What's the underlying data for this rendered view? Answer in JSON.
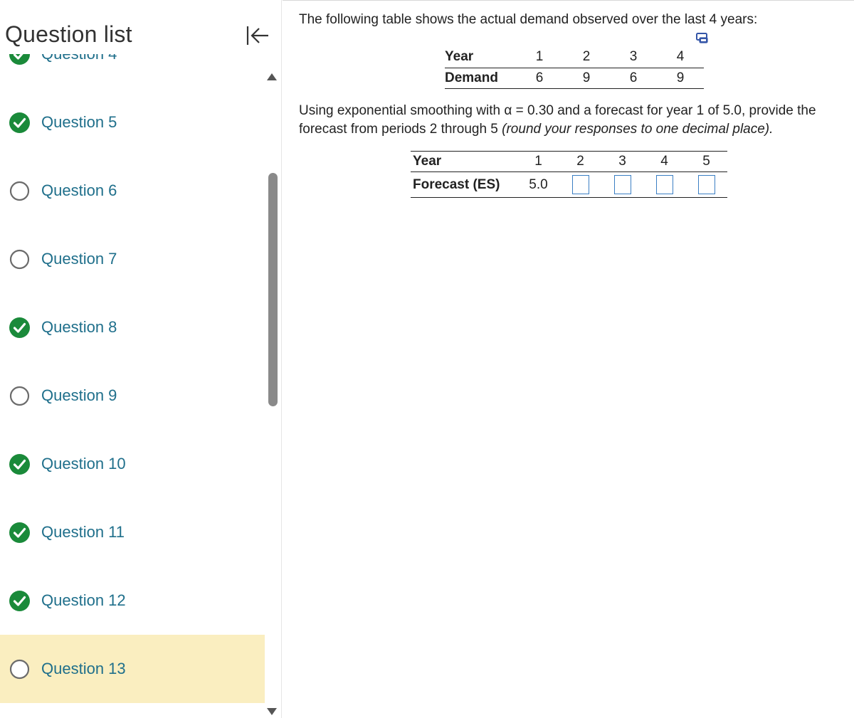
{
  "sidebar": {
    "title": "Question list",
    "items": [
      {
        "label": "Question 4",
        "status": "complete"
      },
      {
        "label": "Question 5",
        "status": "complete"
      },
      {
        "label": "Question 6",
        "status": "incomplete"
      },
      {
        "label": "Question 7",
        "status": "incomplete"
      },
      {
        "label": "Question 8",
        "status": "complete"
      },
      {
        "label": "Question 9",
        "status": "incomplete"
      },
      {
        "label": "Question 10",
        "status": "complete"
      },
      {
        "label": "Question 11",
        "status": "complete"
      },
      {
        "label": "Question 12",
        "status": "complete"
      },
      {
        "label": "Question 13",
        "status": "incomplete",
        "current": true
      }
    ]
  },
  "colors": {
    "complete": "#1a8a3a",
    "incomplete_ring": "#6b6b6b",
    "link": "#1f6f8b",
    "current_bg": "#faeec0",
    "input_border": "#3b7fc4"
  },
  "icons": {
    "collapse": "collapse-left-icon",
    "copy": "copy-table-icon",
    "complete": "check-circle-icon",
    "incomplete": "empty-circle-icon"
  },
  "main": {
    "intro": "The following table shows the actual demand observed over the last 4 years:",
    "demand_table": {
      "year_label": "Year",
      "demand_label": "Demand",
      "years": [
        "1",
        "2",
        "3",
        "4"
      ],
      "demand": [
        "6",
        "9",
        "6",
        "9"
      ]
    },
    "question_prefix": "Using exponential smoothing with α = 0.30 and a forecast for year 1 of 5.0, provide the forecast from periods 2 through 5 ",
    "question_italic": "(round your responses to one decimal place).",
    "forecast_table": {
      "year_label": "Year",
      "forecast_label": "Forecast (ES)",
      "years": [
        "1",
        "2",
        "3",
        "4",
        "5"
      ],
      "forecast_year1": "5.0",
      "inputs": [
        "",
        "",
        "",
        ""
      ]
    }
  }
}
